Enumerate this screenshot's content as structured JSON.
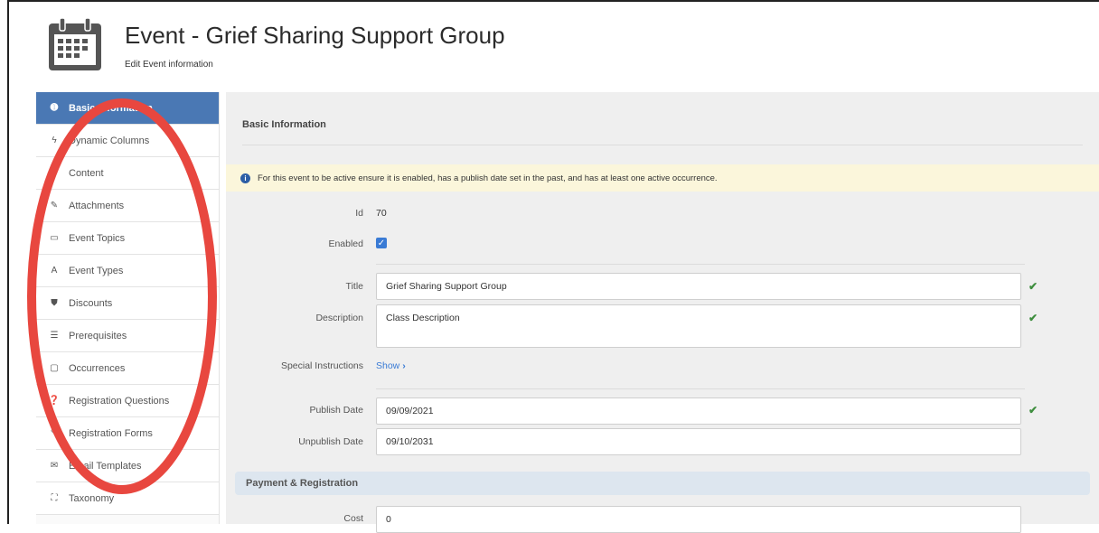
{
  "header": {
    "title": "Event - Grief Sharing Support Group",
    "subtitle": "Edit Event information"
  },
  "sidebar": {
    "items": [
      {
        "label": "Basic Information",
        "icon": "info-icon",
        "glyph": "➊",
        "active": true
      },
      {
        "label": "Dynamic Columns",
        "icon": "bolt-icon",
        "glyph": "ϟ"
      },
      {
        "label": "Content",
        "icon": "file-icon",
        "glyph": "▯"
      },
      {
        "label": "Attachments",
        "icon": "paperclip-icon",
        "glyph": "✎"
      },
      {
        "label": "Event Topics",
        "icon": "folder-icon",
        "glyph": "▭"
      },
      {
        "label": "Event Types",
        "icon": "font-icon",
        "glyph": "A"
      },
      {
        "label": "Discounts",
        "icon": "tag-icon",
        "glyph": "⛊"
      },
      {
        "label": "Prerequisites",
        "icon": "list-icon",
        "glyph": "☰"
      },
      {
        "label": "Occurrences",
        "icon": "calendar-icon",
        "glyph": "▢"
      },
      {
        "label": "Registration Questions",
        "icon": "question-icon",
        "glyph": "❓"
      },
      {
        "label": "Registration Forms",
        "icon": "pencil-icon",
        "glyph": "✎"
      },
      {
        "label": "Email Templates",
        "icon": "envelope-icon",
        "glyph": "✉"
      },
      {
        "label": "Taxonomy",
        "icon": "sitemap-icon",
        "glyph": "⛶"
      }
    ]
  },
  "main": {
    "section_title": "Basic Information",
    "alert": "For this event to be active ensure it is enabled, has a publish date set in the past, and has at least one active occurrence.",
    "fields": {
      "id_label": "Id",
      "id_value": "70",
      "enabled_label": "Enabled",
      "title_label": "Title",
      "title_value": "Grief Sharing Support Group",
      "description_label": "Description",
      "description_value": "Class Description",
      "special_label": "Special Instructions",
      "special_link": "Show",
      "publish_label": "Publish Date",
      "publish_value": "09/09/2021",
      "unpublish_label": "Unpublish Date",
      "unpublish_value": "09/10/2031",
      "payment_section": "Payment & Registration",
      "cost_label": "Cost",
      "cost_value": "0"
    }
  },
  "colors": {
    "accent": "#4a78b4",
    "annotation": "#e8473f",
    "valid": "#3e8e3e",
    "alert_bg": "#fbf6db"
  }
}
